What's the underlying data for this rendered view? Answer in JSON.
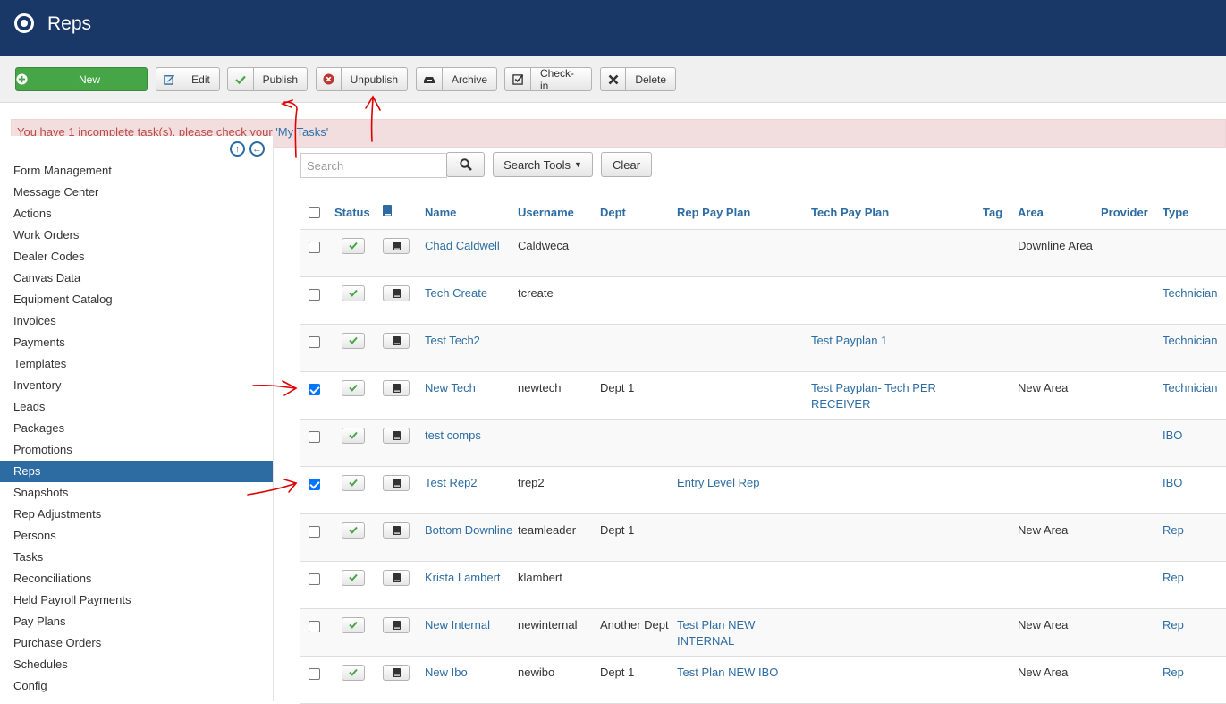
{
  "header": {
    "title": "Reps"
  },
  "toolbar": {
    "new": "New",
    "edit": "Edit",
    "publish": "Publish",
    "unpublish": "Unpublish",
    "archive": "Archive",
    "checkin": "Check-in",
    "delete": "Delete"
  },
  "alert": {
    "text": "You have 1 incomplete task(s). please check your ",
    "link": "'My Tasks'"
  },
  "sidebar": {
    "items": [
      "Form Management",
      "Message Center",
      "Actions",
      "Work Orders",
      "Dealer Codes",
      "Canvas Data",
      "Equipment Catalog",
      "Invoices",
      "Payments",
      "Templates",
      "Inventory",
      "Leads",
      "Packages",
      "Promotions",
      "Reps",
      "Snapshots",
      "Rep Adjustments",
      "Persons",
      "Tasks",
      "Reconciliations",
      "Held Payroll Payments",
      "Pay Plans",
      "Purchase Orders",
      "Schedules",
      "Config"
    ],
    "active": "Reps"
  },
  "filters": {
    "search_placeholder": "Search",
    "search_tools": "Search Tools",
    "clear": "Clear"
  },
  "table": {
    "columns": {
      "status": "Status",
      "name": "Name",
      "username": "Username",
      "dept": "Dept",
      "rep_pay_plan": "Rep Pay Plan",
      "tech_pay_plan": "Tech Pay Plan",
      "tag": "Tag",
      "area": "Area",
      "provider": "Provider",
      "type": "Type"
    },
    "rows": [
      {
        "checked": false,
        "name": "Chad Caldwell",
        "username": "Caldweca",
        "dept": "",
        "rep_pay_plan": "",
        "tech_pay_plan": "",
        "tag": "",
        "area": "Downline Area",
        "provider": "",
        "type": ""
      },
      {
        "checked": false,
        "name": "Tech Create",
        "username": "tcreate",
        "dept": "",
        "rep_pay_plan": "",
        "tech_pay_plan": "",
        "tag": "",
        "area": "",
        "provider": "",
        "type": "Technician"
      },
      {
        "checked": false,
        "name": "Test Tech2",
        "username": "",
        "dept": "",
        "rep_pay_plan": "",
        "tech_pay_plan": "Test Payplan 1",
        "tag": "",
        "area": "",
        "provider": "",
        "type": "Technician"
      },
      {
        "checked": true,
        "name": "New Tech",
        "username": "newtech",
        "dept": "Dept 1",
        "rep_pay_plan": "",
        "tech_pay_plan": "Test Payplan- Tech PER RECEIVER",
        "tag": "",
        "area": "New Area",
        "provider": "",
        "type": "Technician"
      },
      {
        "checked": false,
        "name": "test comps",
        "username": "",
        "dept": "",
        "rep_pay_plan": "",
        "tech_pay_plan": "",
        "tag": "",
        "area": "",
        "provider": "",
        "type": "IBO"
      },
      {
        "checked": true,
        "name": "Test Rep2",
        "username": "trep2",
        "dept": "",
        "rep_pay_plan": "Entry Level Rep",
        "tech_pay_plan": "",
        "tag": "",
        "area": "",
        "provider": "",
        "type": "IBO"
      },
      {
        "checked": false,
        "name": "Bottom Downline",
        "username": "teamleader",
        "dept": "Dept 1",
        "rep_pay_plan": "",
        "tech_pay_plan": "",
        "tag": "",
        "area": "New Area",
        "provider": "",
        "type": "Rep"
      },
      {
        "checked": false,
        "name": "Krista Lambert",
        "username": "klambert",
        "dept": "",
        "rep_pay_plan": "",
        "tech_pay_plan": "",
        "tag": "",
        "area": "",
        "provider": "",
        "type": "Rep"
      },
      {
        "checked": false,
        "name": "New Internal",
        "username": "newinternal",
        "dept": "Another Dept",
        "rep_pay_plan": "Test Plan NEW INTERNAL",
        "tech_pay_plan": "",
        "tag": "",
        "area": "New Area",
        "provider": "",
        "type": "Rep"
      },
      {
        "checked": false,
        "name": "New Ibo",
        "username": "newibo",
        "dept": "Dept 1",
        "rep_pay_plan": "Test Plan NEW IBO",
        "tech_pay_plan": "",
        "tag": "",
        "area": "New Area",
        "provider": "",
        "type": "Rep"
      }
    ]
  },
  "colors": {
    "header_bg": "#1a3867",
    "accent": "#2d6ca2",
    "new_button": "#46a546",
    "annotation": "#e00000"
  }
}
